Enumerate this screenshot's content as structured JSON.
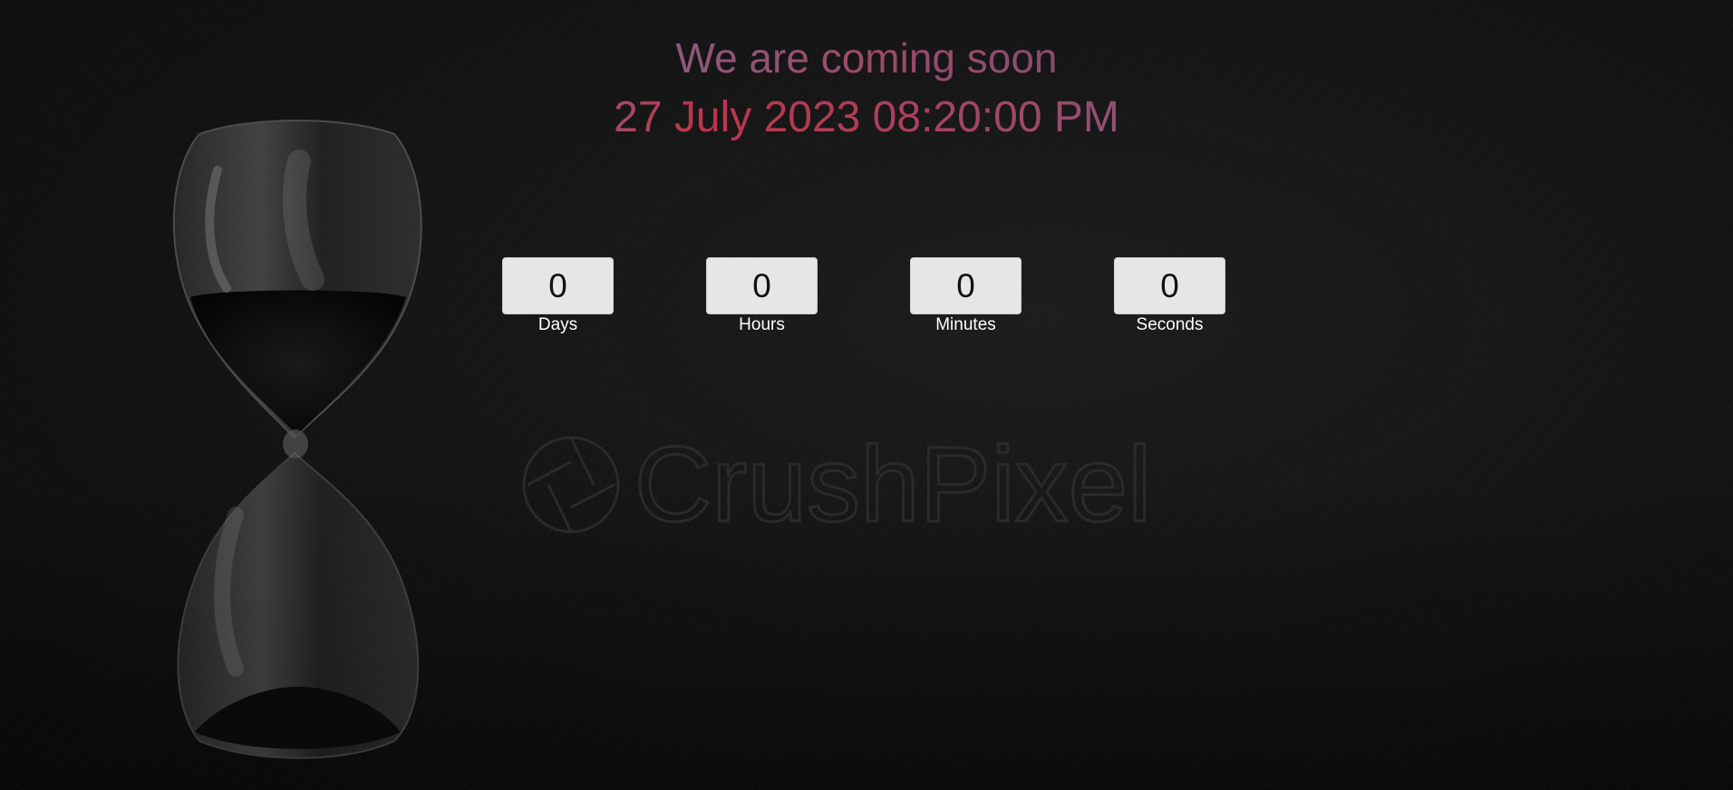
{
  "heading": {
    "title": "We are coming soon",
    "launch_datetime": "27 July 2023 08:20:00 PM"
  },
  "countdown": {
    "days": {
      "value": "0",
      "label": "Days"
    },
    "hours": {
      "value": "0",
      "label": "Hours"
    },
    "minutes": {
      "value": "0",
      "label": "Minutes"
    },
    "seconds": {
      "value": "0",
      "label": "Seconds"
    }
  },
  "watermark": {
    "text": "CrushPixel"
  },
  "background": {
    "image": "hourglass-photo"
  }
}
